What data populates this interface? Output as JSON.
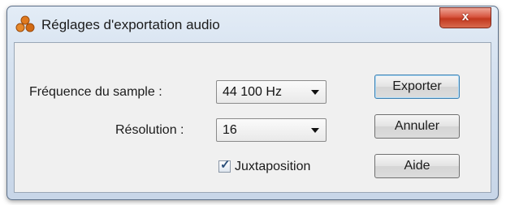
{
  "window": {
    "title": "Réglages d'exportation audio",
    "close_label": "x",
    "app_icon": "triple-sphere-logo-icon"
  },
  "form": {
    "sample_rate_label": "Fréquence du sample :",
    "sample_rate_value": "44 100 Hz",
    "resolution_label": "Résolution :",
    "resolution_value": "16",
    "juxtaposition_label": "Juxtaposition",
    "juxtaposition_checked": true
  },
  "buttons": {
    "export": "Exporter",
    "cancel": "Annuler",
    "help": "Aide"
  },
  "colors": {
    "accent": "#3c7fb1",
    "close": "#c2381f",
    "logo": "#e07a1f"
  }
}
